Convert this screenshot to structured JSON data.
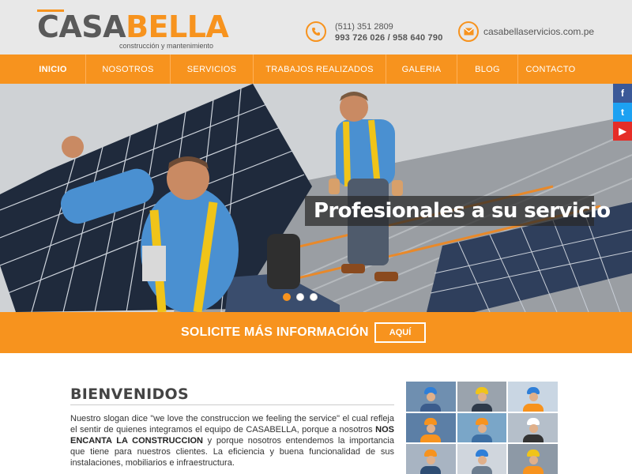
{
  "brand": {
    "name_part1": "CASA",
    "name_part2": "BELLA",
    "tagline": "construcción y mantenimiento"
  },
  "contact": {
    "phone_line1": "(511) 351 2809",
    "phone_line2": "993 726 026 / 958 640 790",
    "email": "casabellaservicios.com.pe",
    "phone_icon": "phone-icon",
    "mail_icon": "mail-icon"
  },
  "nav": {
    "items": [
      {
        "label": "INICIO",
        "active": true
      },
      {
        "label": "NOSOTROS"
      },
      {
        "label": "SERVICIOS"
      },
      {
        "label": "TRABAJOS REALIZADOS"
      },
      {
        "label": "GALERIA"
      },
      {
        "label": "BLOG"
      },
      {
        "label": "CONTACTO"
      }
    ]
  },
  "social": {
    "facebook": "f",
    "twitter": "t",
    "youtube": "▶"
  },
  "hero": {
    "slogan": "Profesionales a su servicio",
    "slides_count": 3,
    "active_slide": 1
  },
  "cta": {
    "text": "SOLICITE MÁS INFORMACIÓN",
    "button": "AQUÍ"
  },
  "welcome": {
    "title": "BIENVENIDOS",
    "body_part1": "Nuestro slogan dice \"we love the construccion we feeling the service\" el cual refleja el sentir de quienes integramos el equipo de CASABELLA, porque a nosotros ",
    "body_bold": "NOS ENCANTA LA CONSTRUCCION",
    "body_part2": " y porque nosotros entendemos la importancia que tiene para nuestros clientes. La eficiencia y buena funcionalidad de sus instalaciones, mobiliarios e infraestructura."
  },
  "colors": {
    "accent": "#f7931e",
    "header_bg": "#e8e8e8",
    "text_dark": "#444444"
  }
}
